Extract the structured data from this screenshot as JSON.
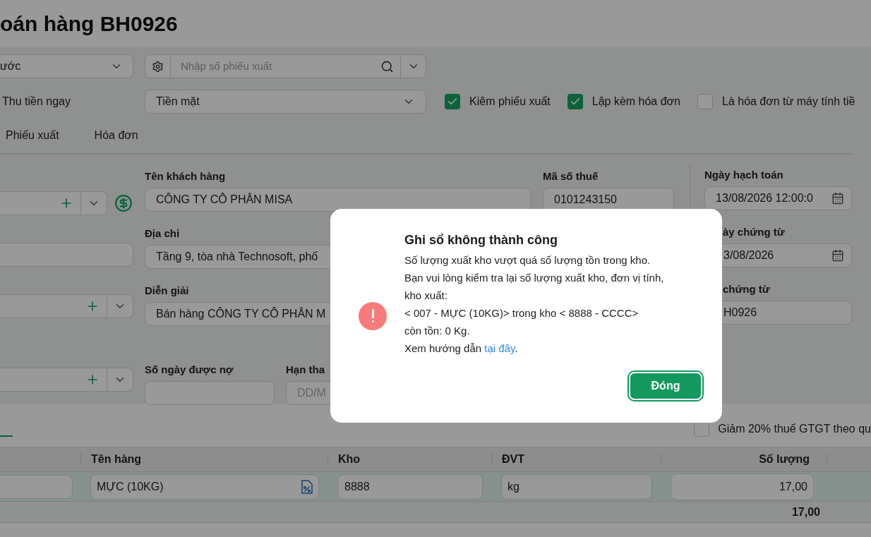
{
  "header": {
    "title": "oán hàng BH0926"
  },
  "toolbar": {
    "template_select": {
      "value": "ước"
    },
    "search": {
      "placeholder": "Nhập số phiếu xuất"
    }
  },
  "payment": {
    "label": "Thu tiền ngay",
    "method": "Tiền mặt",
    "options": [
      {
        "label": "Kiêm phiếu xuất",
        "checked": true
      },
      {
        "label": "Lập kèm hóa đơn",
        "checked": true
      },
      {
        "label": "Là hóa đơn từ máy tính tiề",
        "checked": false
      }
    ]
  },
  "tabs": [
    {
      "label": "Phiếu xuất",
      "selected": false
    },
    {
      "label": "Hóa đơn",
      "selected": false
    }
  ],
  "left_fields": [
    {
      "kind": "combo_add"
    },
    {
      "kind": "text"
    },
    {
      "kind": "combo_add"
    },
    {
      "kind": "combo_add"
    }
  ],
  "customer": {
    "name_label": "Tên khách hàng",
    "name": "CÔNG TY CÔ PHÂN MISA",
    "address_label": "Địa chi",
    "address": "Tầng 9, tòa nhà Technosoft, phố",
    "description_label": "Diễn giải",
    "description": "Bán hàng CÔNG TY CÔ PHÂN M",
    "debt_days_label": "Số ngày được nợ",
    "due_date_label": "Hạn tha",
    "due_date_placeholder": "DD/M",
    "tax_code_label": "Mã số thuế",
    "tax_code": "0101243150"
  },
  "dates": {
    "posting_date_label": "Ngày hạch toán",
    "posting_date": "13/08/2026 12:00:0",
    "voucher_date_label": "ày chứng từ",
    "voucher_date": "3/08/2026",
    "voucher_no_label": "chứng từ",
    "voucher_no": "H0926"
  },
  "detail": {
    "vat_reduction": {
      "label": "Giảm 20% thuế GTGT theo qu",
      "checked": false
    },
    "columns": [
      "Tên hàng",
      "Kho",
      "ĐVT",
      "Số lượng"
    ],
    "rows": [
      {
        "item": "MỰC (10KG)",
        "warehouse": "8888",
        "unit": "kg",
        "quantity": "17,00"
      }
    ],
    "total_quantity": "17,00"
  },
  "dialog": {
    "title": "Ghi sổ không thành công",
    "lines": [
      "Số lượng xuất kho vượt quá số lượng tồn trong kho.",
      "Bạn vui lòng kiểm tra lại số lượng xuất kho, đơn vị tính,",
      "kho xuất:",
      "< 007 - MỰC (10KG)> trong kho < 8888 - CCCC>",
      "còn tồn: 0 Kg."
    ],
    "help": {
      "before": "Xem hướng dẫn ",
      "link": "tại đây",
      "after": "."
    },
    "button": "Đóng"
  }
}
